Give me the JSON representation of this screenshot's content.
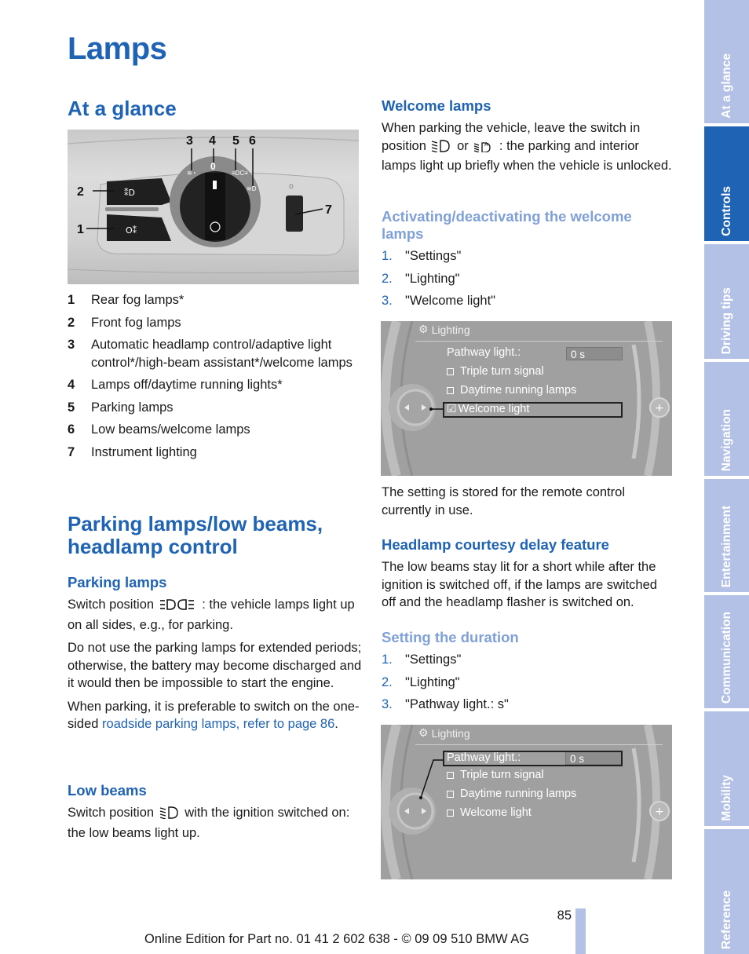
{
  "page": {
    "title": "Lamps",
    "page_number": "85",
    "footer": "Online Edition for Part no. 01 41 2 602 638 - © 09 09 510 BMW AG"
  },
  "side_tabs": [
    {
      "label": "At a glance",
      "active": false
    },
    {
      "label": "Controls",
      "active": true
    },
    {
      "label": "Driving tips",
      "active": false
    },
    {
      "label": "Navigation",
      "active": false
    },
    {
      "label": "Entertainment",
      "active": false
    },
    {
      "label": "Communication",
      "active": false
    },
    {
      "label": "Mobility",
      "active": false
    },
    {
      "label": "Reference",
      "active": false
    }
  ],
  "at_a_glance": {
    "heading": "At a glance",
    "figure_callouts": [
      "1",
      "2",
      "3",
      "4",
      "5",
      "6",
      "7"
    ],
    "switch_zero_label": "0",
    "legend": [
      {
        "num": "1",
        "text": "Rear fog lamps*"
      },
      {
        "num": "2",
        "text": "Front fog lamps"
      },
      {
        "num": "3",
        "text": "Automatic headlamp control/adaptive light control*/high-beam assistant*/welcome lamps"
      },
      {
        "num": "4",
        "text": "Lamps off/daytime running lights*"
      },
      {
        "num": "5",
        "text": "Parking lamps"
      },
      {
        "num": "6",
        "text": "Low beams/welcome lamps"
      },
      {
        "num": "7",
        "text": "Instrument lighting"
      }
    ]
  },
  "parking_section": {
    "heading": "Parking lamps/low beams, headlamp control",
    "parking_lamps": {
      "heading": "Parking lamps",
      "p1_before": "Switch position",
      "p1_after": ": the vehicle lamps light up on all sides, e.g., for parking.",
      "p2": "Do not use the parking lamps for extended periods; otherwise, the battery may become discharged and it would then be impossible to start the engine.",
      "p3_before": "When parking, it is preferable to switch on the one-sided ",
      "p3_link": "roadside parking lamps, refer to page 86",
      "p3_after": "."
    },
    "low_beams": {
      "heading": "Low beams",
      "p_before": "Switch position",
      "p_after": "with the ignition switched on: the low beams light up."
    }
  },
  "welcome_lamps": {
    "heading": "Welcome lamps",
    "p_before": "When parking the vehicle, leave the switch in position",
    "p_or": "or",
    "p_after": ": the parking and interior lamps light up briefly when the vehicle is unlocked.",
    "activating": {
      "heading": "Activating/deactivating the welcome lamps",
      "steps": [
        {
          "num": "1.",
          "text": "\"Settings\""
        },
        {
          "num": "2.",
          "text": "\"Lighting\""
        },
        {
          "num": "3.",
          "text": "\"Welcome light\""
        }
      ]
    },
    "screen": {
      "title": "Lighting",
      "pathway_label": "Pathway light.:",
      "pathway_value": "0 s",
      "items": [
        {
          "label": "Triple turn signal",
          "checked": false
        },
        {
          "label": "Daytime running lamps",
          "checked": false
        },
        {
          "label": "Welcome light",
          "checked": true
        }
      ],
      "selected": "Welcome light"
    },
    "note": "The setting is stored for the remote control currently in use."
  },
  "courtesy_delay": {
    "heading": "Headlamp courtesy delay feature",
    "p": "The low beams stay lit for a short while after the ignition is switched off, if the lamps are switched off and the headlamp flasher is switched on.",
    "duration": {
      "heading": "Setting the duration",
      "steps": [
        {
          "num": "1.",
          "text": "\"Settings\""
        },
        {
          "num": "2.",
          "text": "\"Lighting\""
        },
        {
          "num": "3.",
          "text": "\"Pathway light.: s\""
        }
      ]
    },
    "screen": {
      "title": "Lighting",
      "pathway_label": "Pathway light.:",
      "pathway_value": "0 s",
      "items": [
        {
          "label": "Triple turn signal",
          "checked": false
        },
        {
          "label": "Daytime running lamps",
          "checked": false
        },
        {
          "label": "Welcome light",
          "checked": false
        }
      ],
      "selected": "Pathway light.:"
    }
  },
  "colors": {
    "heading_blue": "#1f63b5",
    "subheading_light_blue": "#7fa0d8",
    "tab_inactive": "#b3c1e6",
    "tab_active": "#1f63b5"
  }
}
